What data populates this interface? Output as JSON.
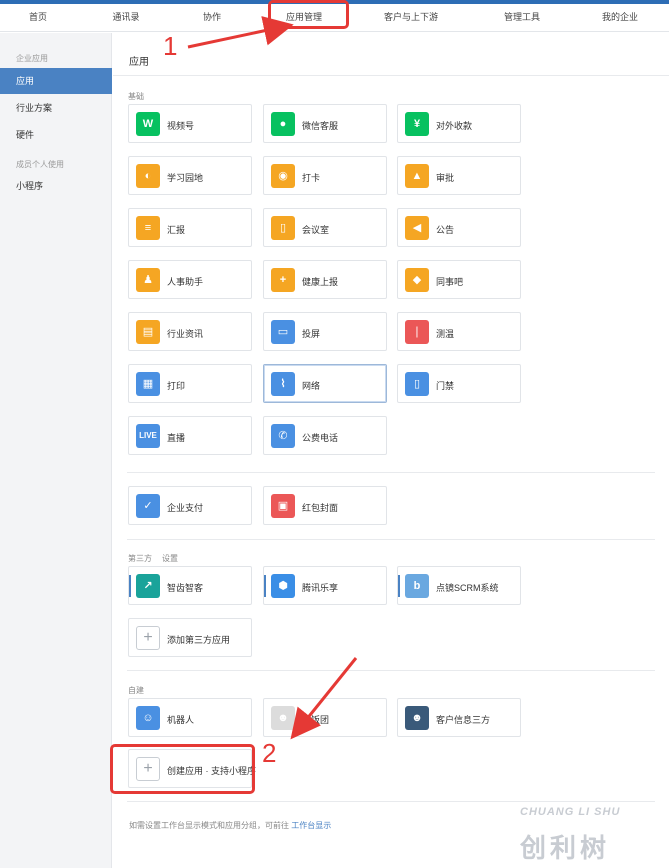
{
  "nav": {
    "items": [
      "首页",
      "通讯录",
      "协作",
      "应用管理",
      "客户与上下游",
      "管理工具",
      "我的企业"
    ]
  },
  "sidebar": {
    "caption1": "企业应用",
    "items1": [
      "应用",
      "行业方案",
      "硬件"
    ],
    "caption2": "成员个人使用",
    "items2": [
      "小程序"
    ]
  },
  "main": {
    "title": "应用",
    "section_basic": "基础",
    "basic_apps": [
      {
        "label": "视频号",
        "icon": "video-channel-icon",
        "color": "#07c160",
        "glyph": "W"
      },
      {
        "label": "微信客服",
        "icon": "wechat-service-icon",
        "color": "#07c160",
        "glyph": "●"
      },
      {
        "label": "对外收款",
        "icon": "payment-icon",
        "color": "#07c160",
        "glyph": "¥"
      },
      {
        "label": "学习园地",
        "icon": "planet-icon",
        "color": "#f5a623",
        "glyph": "◐"
      },
      {
        "label": "打卡",
        "icon": "location-pin-icon",
        "color": "#f5a623",
        "glyph": "◉"
      },
      {
        "label": "审批",
        "icon": "stamp-icon",
        "color": "#f5a623",
        "glyph": "▲"
      },
      {
        "label": "汇报",
        "icon": "report-icon",
        "color": "#f5a623",
        "glyph": "≡"
      },
      {
        "label": "会议室",
        "icon": "door-icon",
        "color": "#f5a623",
        "glyph": "▯"
      },
      {
        "label": "公告",
        "icon": "megaphone-icon",
        "color": "#f5a623",
        "glyph": "◀"
      },
      {
        "label": "人事助手",
        "icon": "person-icon",
        "color": "#f5a623",
        "glyph": "♟"
      },
      {
        "label": "健康上报",
        "icon": "health-report-icon",
        "color": "#f5a623",
        "glyph": "+"
      },
      {
        "label": "同事吧",
        "icon": "colleague-icon",
        "color": "#f5a623",
        "glyph": "◆"
      },
      {
        "label": "行业资讯",
        "icon": "news-icon",
        "color": "#f5a623",
        "glyph": "▤"
      },
      {
        "label": "投屏",
        "icon": "screen-cast-icon",
        "color": "#4a90e2",
        "glyph": "▭"
      },
      {
        "label": "测温",
        "icon": "thermometer-icon",
        "color": "#eb5757",
        "glyph": "❘"
      },
      {
        "label": "打印",
        "icon": "printer-icon",
        "color": "#4a90e2",
        "glyph": "▦"
      },
      {
        "label": "网络",
        "icon": "router-icon",
        "color": "#4a90e2",
        "glyph": "⌇"
      },
      {
        "label": "门禁",
        "icon": "access-control-icon",
        "color": "#4a90e2",
        "glyph": "▯"
      },
      {
        "label": "直播",
        "icon": "live-icon",
        "color": "#4a90e2",
        "glyph": "LIVE"
      },
      {
        "label": "公费电话",
        "icon": "phone-icon",
        "color": "#4a90e2",
        "glyph": "✆"
      }
    ],
    "pay_apps": [
      {
        "label": "企业支付",
        "icon": "enterprise-pay-icon",
        "color": "#4a90e2",
        "glyph": "✓"
      },
      {
        "label": "红包封面",
        "icon": "red-envelope-icon",
        "color": "#eb5757",
        "glyph": "▣"
      }
    ],
    "section_third": "第三方",
    "section_third_link": "设置",
    "third_apps": [
      {
        "label": "智齿智客",
        "icon": "zhichi-icon",
        "color": "#1aa39a",
        "glyph": "↗"
      },
      {
        "label": "腾讯乐享",
        "icon": "tencent-lexiang-icon",
        "color": "#3a8ee6",
        "glyph": "⬢"
      },
      {
        "label": "点镜SCRM系统",
        "icon": "dianjing-icon",
        "color": "#6aa8e0",
        "glyph": "b"
      }
    ],
    "add_third_label": "添加第三方应用",
    "section_custom": "自建",
    "custom_apps": [
      {
        "label": "机器人",
        "icon": "robot-icon",
        "color": "#4a90e2",
        "glyph": "☺"
      },
      {
        "label": "小饭团",
        "icon": "mascot-icon",
        "color": "#dcdcdc",
        "glyph": "☻"
      },
      {
        "label": "客户信息三方",
        "icon": "avatar-icon",
        "color": "#3a5a7a",
        "glyph": "☻"
      }
    ],
    "create_label": "创建应用 · 支持小程序",
    "footer_text": "如需设置工作台显示模式和应用分组，可前往",
    "footer_link": "工作台显示"
  },
  "annotations": {
    "num1": "1",
    "num2": "2"
  },
  "watermark": {
    "en": "CHUANG LI SHU",
    "cn": "创利树"
  }
}
